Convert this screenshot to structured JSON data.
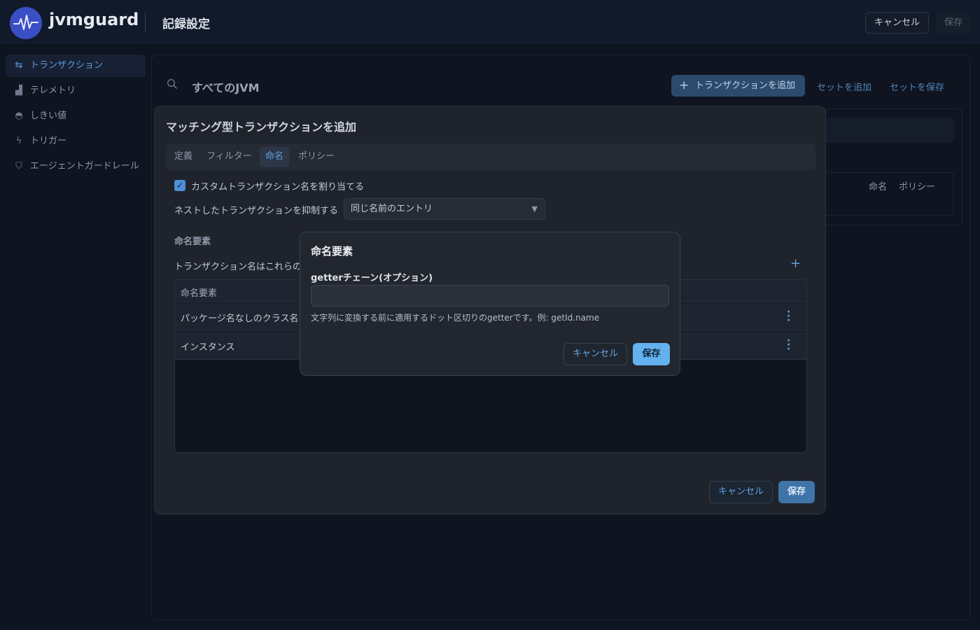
{
  "header": {
    "brand": "jvmguard",
    "title": "記録設定",
    "cancel_label": "キャンセル",
    "save_label": "保存"
  },
  "sidebar": {
    "items": [
      {
        "label": "トランザクション",
        "icon": "transaction-icon",
        "active": true
      },
      {
        "label": "テレメトリ",
        "icon": "chart-icon",
        "active": false
      },
      {
        "label": "しきい値",
        "icon": "gauge-icon",
        "active": false
      },
      {
        "label": "トリガー",
        "icon": "lightning-icon",
        "active": false
      },
      {
        "label": "エージェントガードレール",
        "icon": "shield-icon",
        "active": false
      }
    ]
  },
  "main": {
    "scope_label": "すべてのJVM",
    "add_transaction_label": "トランザクションを追加",
    "add_set_label": "セットを追加",
    "save_set_label": "セットを保存",
    "columns": {
      "naming": "命名",
      "policy": "ポリシー"
    }
  },
  "modal": {
    "title": "マッチング型トランザクションを追加",
    "tabs": [
      {
        "label": "定義",
        "active": false
      },
      {
        "label": "フィルター",
        "active": false
      },
      {
        "label": "命名",
        "active": true
      },
      {
        "label": "ポリシー",
        "active": false
      }
    ],
    "custom_name_checkbox_label": "カスタムトランザクション名を割り当てる",
    "custom_name_checked": true,
    "suppress_label": "ネストしたトランザクションを抑制する",
    "suppress_value": "同じ名前のエントリ",
    "section_label": "命名要素",
    "description": "トランザクション名はこれらの",
    "table": {
      "header": "命名要素",
      "rows": [
        {
          "label": "パッケージ名なしのクラス名"
        },
        {
          "label": "インスタンス"
        }
      ]
    },
    "cancel_label": "キャンセル",
    "save_label": "保存"
  },
  "dialog": {
    "title": "命名要素",
    "field_label": "getterチェーン(オプション)",
    "field_value": "",
    "help_text": "文字列に変換する前に適用するドット区切りのgetterです。例: getId.name",
    "cancel_label": "キャンセル",
    "save_label": "保存"
  }
}
